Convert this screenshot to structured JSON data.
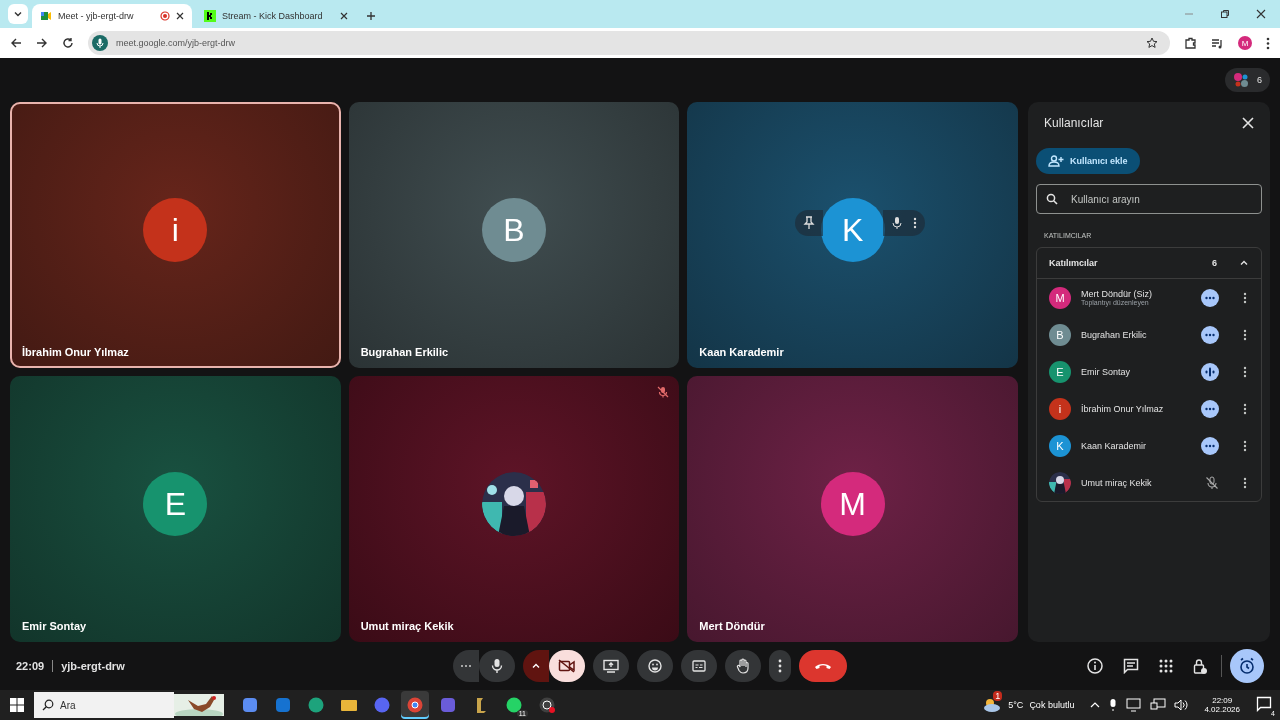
{
  "browser": {
    "tabs": [
      {
        "title": "Meet - yjb-ergt-drw",
        "selected": true,
        "recording": true,
        "kind": "meet"
      },
      {
        "title": "Stream - Kick Dashboard",
        "selected": false,
        "recording": false,
        "kind": "kick"
      }
    ],
    "url": "meet.google.com/yjb-ergt-drw",
    "profile_initial": "M"
  },
  "meet": {
    "participant_count": "6",
    "tiles": [
      {
        "name": "İbrahim Onur Yılmaz",
        "initial": "i",
        "color": "#c4321b",
        "kind": "initial",
        "highlighted": true,
        "muted": false,
        "hover_controls": false
      },
      {
        "name": "Bugrahan Erkilic",
        "initial": "B",
        "color": "#6f8c92",
        "kind": "initial",
        "highlighted": false,
        "muted": false,
        "hover_controls": false
      },
      {
        "name": "Kaan Karademir",
        "initial": "K",
        "color": "#1c93d4",
        "kind": "initial",
        "highlighted": false,
        "muted": false,
        "hover_controls": true
      },
      {
        "name": "Emir Sontay",
        "initial": "E",
        "color": "#17936e",
        "kind": "initial",
        "highlighted": false,
        "muted": false,
        "hover_controls": false
      },
      {
        "name": "Umut miraç Kekik",
        "kind": "picture",
        "highlighted": false,
        "muted": true,
        "hover_controls": false
      },
      {
        "name": "Mert Döndür",
        "initial": "M",
        "color": "#d42a7c",
        "kind": "initial",
        "highlighted": false,
        "muted": false,
        "hover_controls": false
      }
    ],
    "panel": {
      "title": "Kullanıcılar",
      "add_button": "Kullanıcı ekle",
      "search_placeholder": "Kullanıcı arayın",
      "section_label": "KATILIMCILAR",
      "group": {
        "title": "Katılımcılar",
        "count": "6",
        "expanded": true
      },
      "participants": [
        {
          "name": "Mert Döndür (Siz)",
          "subtitle": "Toplantıyı düzenleyen",
          "initial": "M",
          "color": "#d42a7c",
          "kind": "initial",
          "speaking": false,
          "muted": false
        },
        {
          "name": "Bugrahan Erkilic",
          "initial": "B",
          "color": "#6f8c92",
          "kind": "initial",
          "speaking": false,
          "muted": false
        },
        {
          "name": "Emir Sontay",
          "initial": "E",
          "color": "#17936e",
          "kind": "initial",
          "speaking": true,
          "muted": false
        },
        {
          "name": "İbrahim Onur Yılmaz",
          "initial": "i",
          "color": "#c4321b",
          "kind": "initial",
          "speaking": false,
          "muted": false
        },
        {
          "name": "Kaan Karademir",
          "initial": "K",
          "color": "#1c93d4",
          "kind": "initial",
          "speaking": false,
          "muted": false
        },
        {
          "name": "Umut miraç Kekik",
          "kind": "picture",
          "speaking": false,
          "muted": true
        }
      ]
    },
    "time": "22:09",
    "meeting_code": "yjb-ergt-drw",
    "mic_on": true,
    "camera_on": false
  },
  "taskbar": {
    "search_placeholder": "Ara",
    "apps": [
      {
        "kind": "copilot",
        "selected": false
      },
      {
        "kind": "outlook",
        "selected": false
      },
      {
        "kind": "edge",
        "selected": false
      },
      {
        "kind": "folder",
        "selected": false
      },
      {
        "kind": "discord",
        "selected": false
      },
      {
        "kind": "chrome",
        "selected": true
      },
      {
        "kind": "store",
        "selected": false
      },
      {
        "kind": "league",
        "selected": false
      },
      {
        "kind": "whatsapp",
        "selected": false,
        "badge": "11"
      },
      {
        "kind": "obs",
        "selected": false
      }
    ],
    "weather": {
      "temperature": "5°C",
      "condition": "Çok bulutlu",
      "badge": "1"
    },
    "clock": {
      "time": "22:09",
      "date": "4.02.2026"
    },
    "notifications": "4"
  }
}
